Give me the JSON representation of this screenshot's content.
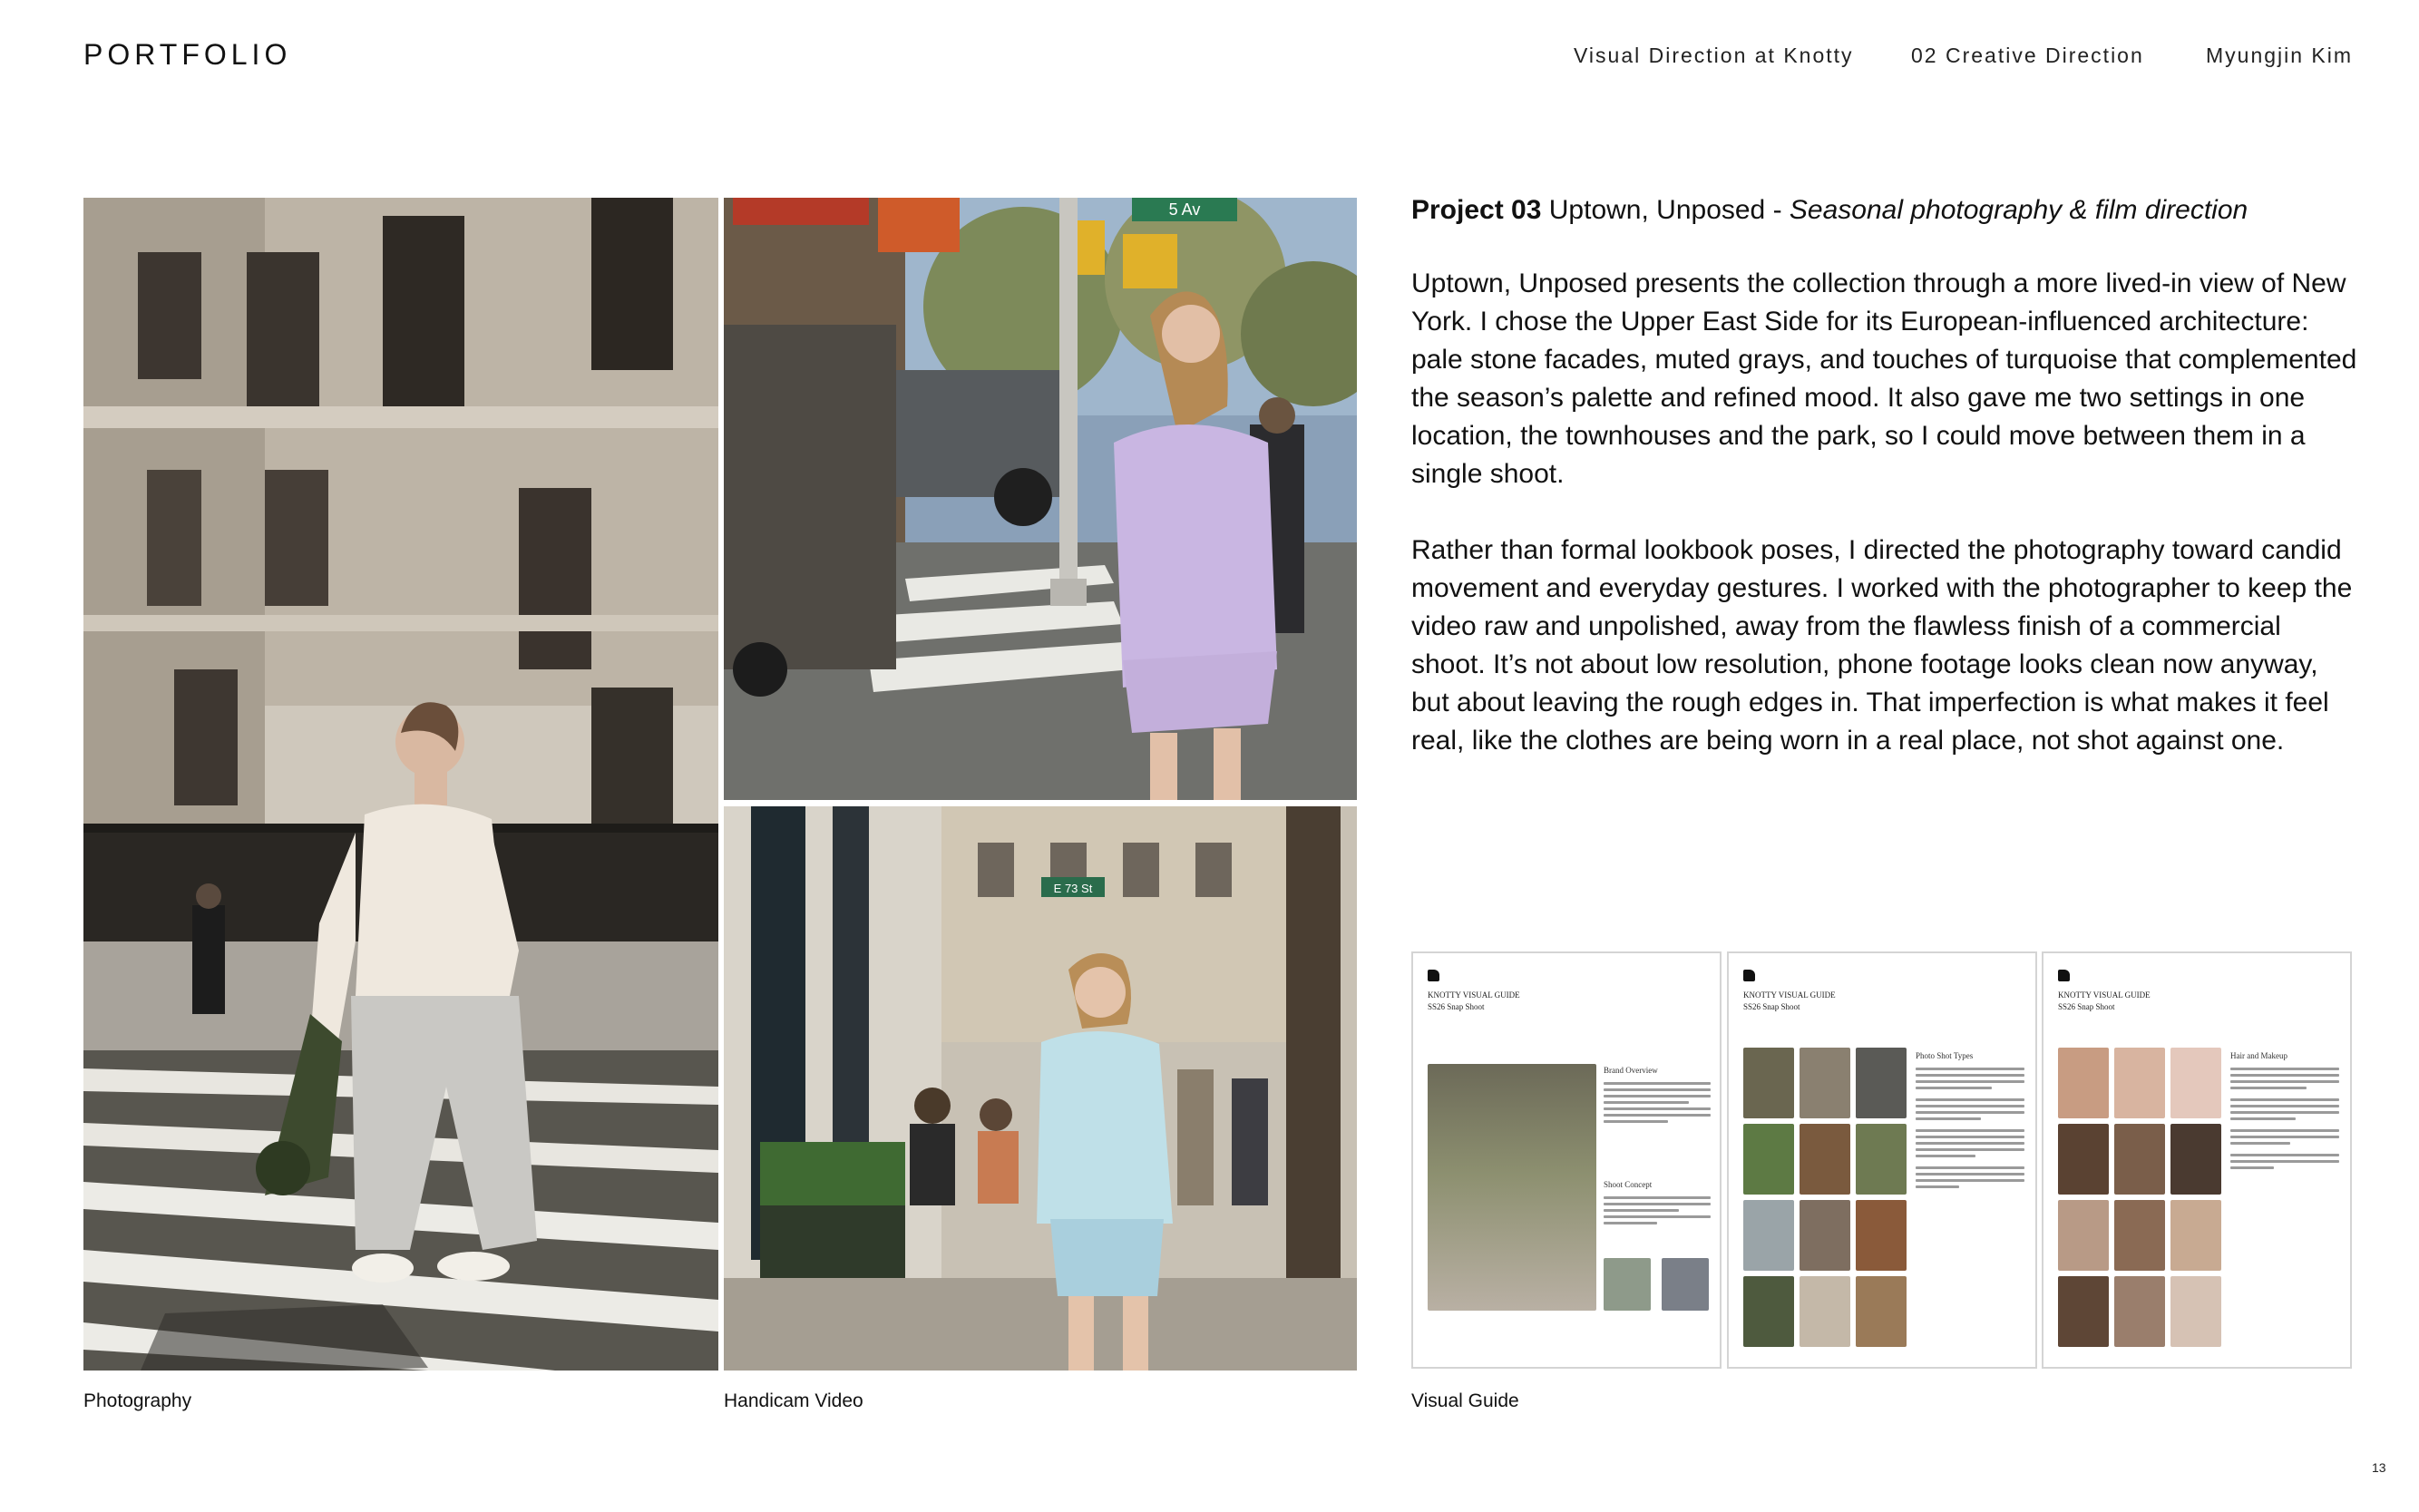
{
  "header": {
    "brand": "PORTFOLIO",
    "nav": [
      "Visual Direction at Knotty",
      "02  Creative Direction",
      "Myungjin Kim"
    ]
  },
  "project": {
    "number": "Project 03",
    "name": "Uptown, Unposed",
    "separator": " - ",
    "subtitle": "Seasonal photography & film direction",
    "paragraphs": [
      "Uptown, Unposed presents the collection through a more lived-in view of New York. I chose the Upper East Side for its European-influenced architecture: pale stone facades, muted grays, and touches of turquoise that complemented the season’s palette and refined mood. It also gave me two settings in one location, the townhouses and the park, so I could move between them in a single shoot.",
      "Rather than formal lookbook poses, I directed the photography toward candid movement and everyday gestures. I worked with the photographer to keep the video raw and unpolished, away from the flawless finish of a commercial shoot. It’s not about low resolution, phone footage looks clean now anyway, but about leaving the rough edges in. That imperfection is what makes it feel real, like the clothes are being worn in a real place, not shot against one."
    ]
  },
  "photos": {
    "street_sign": "5 Av",
    "street_sign_2": "E 73 St"
  },
  "captions": {
    "photography": "Photography",
    "handicam": "Handicam Video",
    "visual_guide": "Visual Guide"
  },
  "guide_pages": [
    {
      "title": "KNOTTY VISUAL GUIDE",
      "subtitle": "SS26 Snap Shoot",
      "section_a": "Brand Overview",
      "section_b": "Shoot Concept"
    },
    {
      "title": "KNOTTY VISUAL GUIDE",
      "subtitle": "SS26 Snap Shoot",
      "section_a": "Photo Shot Types",
      "section_b": ""
    },
    {
      "title": "KNOTTY VISUAL GUIDE",
      "subtitle": "SS26 Snap Shoot",
      "section_a": "Hair and Makeup",
      "section_b": ""
    }
  ],
  "page_number": "13"
}
